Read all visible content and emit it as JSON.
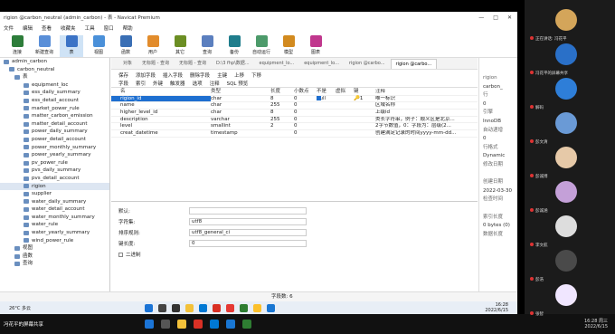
{
  "window": {
    "title": "rigion @carbon_neutral (admin_carbon) - 表 - Navicat Premium",
    "controls": [
      "—",
      "□",
      "✕"
    ]
  },
  "menu": [
    "文件",
    "编辑",
    "查看",
    "收藏夹",
    "工具",
    "窗口",
    "帮助"
  ],
  "toolbar": [
    {
      "label": "连接",
      "icon": "connection-icon",
      "color": "#2d7d3a"
    },
    {
      "label": "新建查询",
      "icon": "new-query-icon",
      "color": "#5a8fd8"
    },
    {
      "label": "表",
      "icon": "table-icon",
      "color": "#3b73c6",
      "active": true
    },
    {
      "label": "视图",
      "icon": "view-icon",
      "color": "#4a90d9"
    },
    {
      "label": "函数",
      "icon": "function-icon",
      "color": "#3a6fb5"
    },
    {
      "label": "用户",
      "icon": "user-icon",
      "color": "#e28c2c"
    },
    {
      "label": "其它",
      "icon": "other-icon",
      "color": "#6b8e23"
    },
    {
      "label": "查询",
      "icon": "query-icon",
      "color": "#5b7fbf"
    },
    {
      "label": "备份",
      "icon": "backup-icon",
      "color": "#1f7d8c"
    },
    {
      "label": "自动运行",
      "icon": "automation-icon",
      "color": "#4c9a6a"
    },
    {
      "label": "模型",
      "icon": "model-icon",
      "color": "#d28a1f"
    },
    {
      "label": "图表",
      "icon": "chart-icon",
      "color": "#c0378d"
    }
  ],
  "sidebar": {
    "connection": "admin_carbon",
    "database": "carbon_neutral",
    "tables_group": "表",
    "tables": [
      "equipment_loc",
      "ess_daily_summary",
      "ess_detail_account",
      "market_power_rule",
      "matter_carbon_emission",
      "matter_detail_account",
      "power_daily_summary",
      "power_detail_account",
      "power_monthly_summary",
      "power_yearly_summary",
      "pv_power_rule",
      "pvs_daily_summary",
      "pvs_detail_account",
      "rigion",
      "supplier",
      "water_daily_summary",
      "water_detail_account",
      "water_monthly_summary",
      "water_rule",
      "water_yearly_summary",
      "wind_power_rule"
    ],
    "selected": "rigion",
    "other_groups": [
      "视图",
      "函数",
      "查询"
    ]
  },
  "tabs": [
    "对象",
    "无标题 - 查询",
    "无标题 - 查询",
    "D:\\3 fhp\\数据...",
    "equipment_lo...",
    "equipment_lo...",
    "rigion @carbo...",
    "rigion @carbo..."
  ],
  "actions": [
    "保存",
    "添加字段",
    "插入字段",
    "删除字段",
    "主键",
    "上移",
    "下移"
  ],
  "subtabs": [
    "字段",
    "索引",
    "外键",
    "触发器",
    "选项",
    "注释",
    "SQL 预览"
  ],
  "grid": {
    "headers": [
      "名",
      "类型",
      "长度",
      "小数点",
      "不是 null",
      "虚拟",
      "键",
      "注释"
    ],
    "rows": [
      {
        "name": "rigion_id",
        "type": "char",
        "length": "8",
        "decimals": "0",
        "notnull": true,
        "key": "🔑1",
        "comment": "唯一标识"
      },
      {
        "name": "name",
        "type": "char",
        "length": "255",
        "decimals": "0",
        "notnull": false,
        "key": "",
        "comment": "区域名称"
      },
      {
        "name": "higher_level_id",
        "type": "char",
        "length": "8",
        "decimals": "0",
        "notnull": false,
        "key": "",
        "comment": "上级id"
      },
      {
        "name": "description",
        "type": "varchar",
        "length": "255",
        "decimals": "0",
        "notnull": false,
        "key": "",
        "comment": "类长字符串，例子：顺义区是北京..."
      },
      {
        "name": "level",
        "type": "smallint",
        "length": "2",
        "decimals": "0",
        "notnull": false,
        "key": "",
        "comment": "2字节数值，0：字段为：层级(2..."
      },
      {
        "name": "creat_datetime",
        "type": "timestamp",
        "length": "",
        "decimals": "0",
        "notnull": false,
        "key": "",
        "comment": "创建满足记录的时间yyyy-mm-dd..."
      }
    ]
  },
  "props": [
    {
      "label": "默认:",
      "value": ""
    },
    {
      "label": "字符集:",
      "value": "utf8"
    },
    {
      "label": "排序规则:",
      "value": "utf8_general_ci"
    },
    {
      "label": "键长度:",
      "value": "0"
    }
  ],
  "binary_label": "二进制",
  "right_panel": [
    "rigion",
    "carbon_",
    "行",
    "0",
    "引擎",
    "InnoDB",
    "自动递增",
    "0",
    "行格式",
    "Dynamic",
    "修改日期",
    "",
    "创建日期",
    "2022-03-30",
    "检查时间",
    "",
    "索引长度",
    "0 bytes (0)",
    "数据长度"
  ],
  "status": "字段数: 6",
  "taskbar": {
    "weather_temp": "26°C",
    "weather_desc": "多云",
    "time": "16:28",
    "date": "2022/6/15"
  },
  "bottom": {
    "user_label": "冯花平的屏幕共享",
    "time": "16:28 周三",
    "date": "2022/6/15"
  },
  "participants": [
    {
      "name": "正在讲话: 冯花平",
      "color": "#d4a55a"
    },
    {
      "name": "冯花平的屏幕共享",
      "color": "#2a70c8"
    },
    {
      "name": "解码",
      "color": "#2e7ed8"
    },
    {
      "name": "彭文清",
      "color": "#6a9ad6"
    },
    {
      "name": "彭诚博",
      "color": "#e6c9a8"
    },
    {
      "name": "彭诚涵",
      "color": "#c4a0d8"
    },
    {
      "name": "李文航",
      "color": "#dddddd"
    },
    {
      "name": "彭浩",
      "color": "#4a4a4a"
    },
    {
      "name": "张智",
      "color": "#f0e6ff"
    }
  ]
}
